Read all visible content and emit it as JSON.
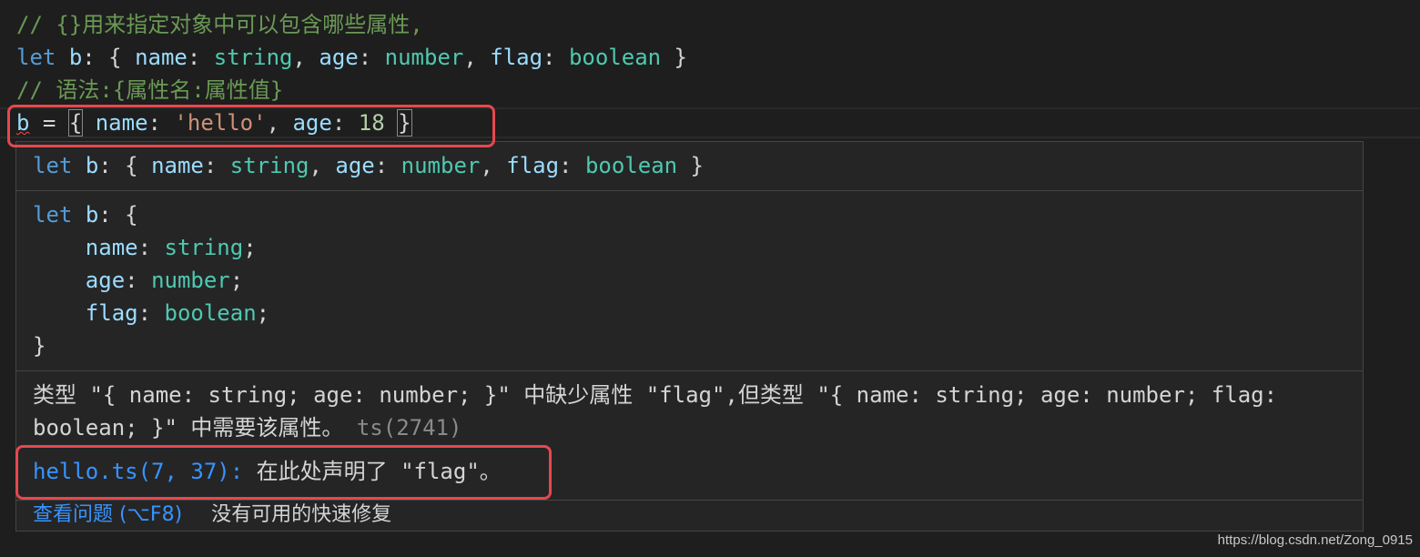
{
  "editor": {
    "lines": [
      [
        {
          "t": "// {}用来指定对象中可以包含哪些属性,",
          "c": "cm"
        }
      ],
      [
        {
          "t": "let",
          "c": "kw"
        },
        {
          "t": " ",
          "c": "pl"
        },
        {
          "t": "b",
          "c": "var"
        },
        {
          "t": ": { ",
          "c": "pl"
        },
        {
          "t": "name",
          "c": "var"
        },
        {
          "t": ": ",
          "c": "pl"
        },
        {
          "t": "string",
          "c": "ty"
        },
        {
          "t": ", ",
          "c": "pl"
        },
        {
          "t": "age",
          "c": "var"
        },
        {
          "t": ": ",
          "c": "pl"
        },
        {
          "t": "number",
          "c": "ty"
        },
        {
          "t": ", ",
          "c": "pl"
        },
        {
          "t": "flag",
          "c": "var"
        },
        {
          "t": ": ",
          "c": "pl"
        },
        {
          "t": "boolean",
          "c": "ty"
        },
        {
          "t": " }",
          "c": "pl"
        }
      ],
      [
        {
          "t": "// 语法:{属性名:属性值}",
          "c": "cm"
        }
      ],
      [
        {
          "t": "b",
          "c": "var err"
        },
        {
          "t": " = ",
          "c": "pl"
        },
        {
          "t": "{",
          "c": "pl br"
        },
        {
          "t": " ",
          "c": "pl"
        },
        {
          "t": "name",
          "c": "var"
        },
        {
          "t": ": ",
          "c": "pl"
        },
        {
          "t": "'hello'",
          "c": "str"
        },
        {
          "t": ", ",
          "c": "pl"
        },
        {
          "t": "age",
          "c": "var"
        },
        {
          "t": ": ",
          "c": "pl"
        },
        {
          "t": "18",
          "c": "num"
        },
        {
          "t": " ",
          "c": "pl"
        },
        {
          "t": "}",
          "c": "pl br"
        }
      ]
    ]
  },
  "hover": {
    "signature": [
      {
        "t": "let",
        "c": "kw"
      },
      {
        "t": " ",
        "c": "pl"
      },
      {
        "t": "b",
        "c": "var"
      },
      {
        "t": ": { ",
        "c": "pl"
      },
      {
        "t": "name",
        "c": "var"
      },
      {
        "t": ": ",
        "c": "pl"
      },
      {
        "t": "string",
        "c": "ty"
      },
      {
        "t": ", ",
        "c": "pl"
      },
      {
        "t": "age",
        "c": "var"
      },
      {
        "t": ": ",
        "c": "pl"
      },
      {
        "t": "number",
        "c": "ty"
      },
      {
        "t": ", ",
        "c": "pl"
      },
      {
        "t": "flag",
        "c": "var"
      },
      {
        "t": ": ",
        "c": "pl"
      },
      {
        "t": "boolean",
        "c": "ty"
      },
      {
        "t": " }",
        "c": "pl"
      }
    ],
    "expanded": [
      [
        {
          "t": "let",
          "c": "kw"
        },
        {
          "t": " ",
          "c": "pl"
        },
        {
          "t": "b",
          "c": "var"
        },
        {
          "t": ": {",
          "c": "pl"
        }
      ],
      [
        {
          "t": "    ",
          "c": "pl"
        },
        {
          "t": "name",
          "c": "var"
        },
        {
          "t": ": ",
          "c": "pl"
        },
        {
          "t": "string",
          "c": "ty"
        },
        {
          "t": ";",
          "c": "pl"
        }
      ],
      [
        {
          "t": "    ",
          "c": "pl"
        },
        {
          "t": "age",
          "c": "var"
        },
        {
          "t": ": ",
          "c": "pl"
        },
        {
          "t": "number",
          "c": "ty"
        },
        {
          "t": ";",
          "c": "pl"
        }
      ],
      [
        {
          "t": "    ",
          "c": "pl"
        },
        {
          "t": "flag",
          "c": "var"
        },
        {
          "t": ": ",
          "c": "pl"
        },
        {
          "t": "boolean",
          "c": "ty"
        },
        {
          "t": ";",
          "c": "pl"
        }
      ],
      [
        {
          "t": "}",
          "c": "pl"
        }
      ]
    ],
    "error_line1": "类型 \"{ name: string; age: number; }\" 中缺少属性 \"flag\",但类型 \"{ name: string; age: number; flag:",
    "error_line2": "boolean; }\" 中需要该属性。",
    "error_code": "ts(2741)",
    "related_link": "hello.ts(7, 37):",
    "related_text": " 在此处声明了 \"flag\"。",
    "view_problem": "查看问题 (⌥F8)",
    "no_quick_fix": "没有可用的快速修复"
  },
  "watermark": "https://blog.csdn.net/Zong_0915",
  "colors": {
    "highlight": "#e5484d",
    "link": "#3794ff",
    "background": "#1e1e1e",
    "hover_bg": "#252526"
  }
}
